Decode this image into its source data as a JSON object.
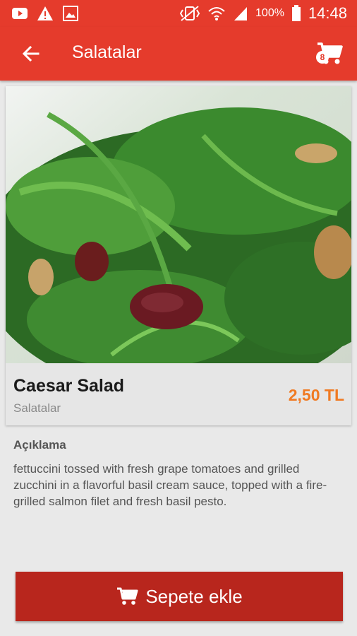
{
  "status_bar": {
    "battery_percent": "100%",
    "time": "14:48",
    "left_icons": [
      "youtube-icon",
      "warning-icon",
      "image-icon"
    ],
    "right_icons": [
      "vibrate-icon",
      "wifi-icon",
      "signal-icon",
      "battery-icon"
    ]
  },
  "app_bar": {
    "title": "Salatalar",
    "cart_count": "8"
  },
  "product": {
    "name": "Caesar Salad",
    "category": "Salatalar",
    "price": "2,50 TL",
    "image": "salad-photo"
  },
  "description": {
    "title": "Açıklama",
    "text": "fettuccini tossed with fresh grape tomatoes and grilled zucchini in a flavorful basil cream sauce, topped with a fire-grilled salmon filet and fresh basil pesto."
  },
  "actions": {
    "add_to_cart_label": "Sepete ekle"
  },
  "colors": {
    "primary": "#e53b2c",
    "button": "#b8261d",
    "price": "#f07a22"
  }
}
